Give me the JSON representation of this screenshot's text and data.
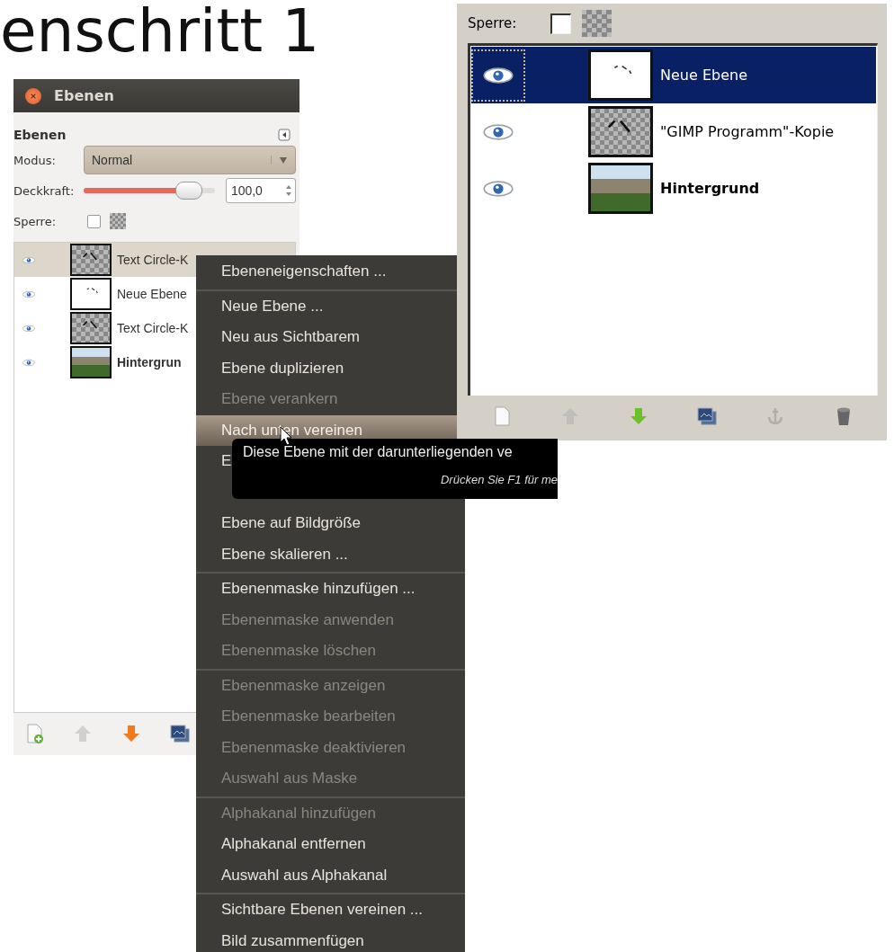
{
  "slide_title": "enschritt 1",
  "layers_dialog": {
    "title": "Ebenen",
    "heading": "Ebenen",
    "mode_label": "Modus:",
    "mode_value": "Normal",
    "opacity_label": "Deckkraft:",
    "opacity": {
      "level": 0.88,
      "value": "100,0"
    },
    "lock_label": "Sperre:",
    "lock_pixels": {
      "checked": false
    },
    "layers": [
      {
        "name": "Text Circle-K",
        "kind": "transparent",
        "visible": true,
        "selected": true,
        "bold": false
      },
      {
        "name": "Neue Ebene",
        "kind": "white",
        "visible": true,
        "selected": false,
        "bold": false
      },
      {
        "name": "Text Circle-K",
        "kind": "transparent",
        "visible": true,
        "selected": false,
        "bold": false
      },
      {
        "name": "Hintergrun",
        "kind": "photo",
        "visible": true,
        "selected": false,
        "bold": true
      }
    ],
    "toolbar": [
      {
        "kind": "new",
        "disabled": false
      },
      {
        "kind": "up",
        "disabled": true
      },
      {
        "kind": "down",
        "disabled": false
      },
      {
        "kind": "duplicate",
        "disabled": false
      }
    ]
  },
  "context_menu": {
    "items": [
      {
        "kind": "item",
        "label": "Ebeneneigenschaften ...",
        "disabled": false,
        "selected": false,
        "separator_before": false
      },
      {
        "kind": "item",
        "label": "Neue Ebene ...",
        "disabled": false,
        "selected": false,
        "separator_before": true
      },
      {
        "kind": "item",
        "label": "Neu aus Sichtbarem",
        "disabled": false,
        "selected": false,
        "separator_before": false
      },
      {
        "kind": "item",
        "label": "Ebene duplizieren",
        "disabled": false,
        "selected": false,
        "separator_before": false
      },
      {
        "kind": "item",
        "label": "Ebene verankern",
        "disabled": true,
        "selected": false,
        "separator_before": false
      },
      {
        "kind": "item",
        "label": "Nach unten vereinen",
        "disabled": false,
        "selected": true,
        "separator_before": false
      },
      {
        "kind": "item",
        "label": "E",
        "disabled": false,
        "selected": false,
        "separator_before": false
      },
      {
        "kind": "covered"
      },
      {
        "kind": "item",
        "label": "Ebene auf Bildgröße",
        "disabled": false,
        "selected": false,
        "separator_before": false
      },
      {
        "kind": "item",
        "label": "Ebene skalieren ...",
        "disabled": false,
        "selected": false,
        "separator_before": false
      },
      {
        "kind": "item",
        "label": "Ebenenmaske hinzufügen ...",
        "disabled": false,
        "selected": false,
        "separator_before": true
      },
      {
        "kind": "item",
        "label": "Ebenenmaske anwenden",
        "disabled": true,
        "selected": false,
        "separator_before": false
      },
      {
        "kind": "item",
        "label": "Ebenenmaske löschen",
        "disabled": true,
        "selected": false,
        "separator_before": false
      },
      {
        "kind": "item",
        "label": "Ebenenmaske anzeigen",
        "disabled": true,
        "selected": false,
        "separator_before": true
      },
      {
        "kind": "item",
        "label": "Ebenenmaske bearbeiten",
        "disabled": true,
        "selected": false,
        "separator_before": false
      },
      {
        "kind": "item",
        "label": "Ebenenmaske deaktivieren",
        "disabled": true,
        "selected": false,
        "separator_before": false
      },
      {
        "kind": "item",
        "label": "Auswahl aus Maske",
        "disabled": true,
        "selected": false,
        "separator_before": false
      },
      {
        "kind": "item",
        "label": "Alphakanal hinzufügen",
        "disabled": true,
        "selected": false,
        "separator_before": true
      },
      {
        "kind": "item",
        "label": "Alphakanal entfernen",
        "disabled": false,
        "selected": false,
        "separator_before": false
      },
      {
        "kind": "item",
        "label": "Auswahl aus Alphakanal",
        "disabled": false,
        "selected": false,
        "separator_before": false
      },
      {
        "kind": "item",
        "label": "Sichtbare Ebenen vereinen ...",
        "disabled": false,
        "selected": false,
        "separator_before": true
      },
      {
        "kind": "item",
        "label": "Bild zusammenfügen",
        "disabled": false,
        "selected": false,
        "separator_before": false
      }
    ]
  },
  "tooltip": {
    "text": "Diese Ebene mit der darunterliegenden ve",
    "hint": "Drücken Sie F1 für me"
  },
  "layers_panel": {
    "lock_label": "Sperre:",
    "lock_pixels": {
      "checked": false
    },
    "layers": [
      {
        "name": "Neue Ebene",
        "kind": "white",
        "visible": true,
        "selected": true,
        "bold": false
      },
      {
        "name": "\"GIMP Programm\"-Kopie",
        "kind": "transparent",
        "visible": true,
        "selected": false,
        "bold": false
      },
      {
        "name": "Hintergrund",
        "kind": "photo",
        "visible": true,
        "selected": false,
        "bold": true
      }
    ],
    "toolbar": [
      {
        "kind": "new",
        "disabled": false
      },
      {
        "kind": "up",
        "disabled": true
      },
      {
        "kind": "down",
        "disabled": false
      },
      {
        "kind": "duplicate",
        "disabled": false
      },
      {
        "kind": "anchor",
        "disabled": true
      },
      {
        "kind": "delete",
        "disabled": false
      }
    ]
  }
}
